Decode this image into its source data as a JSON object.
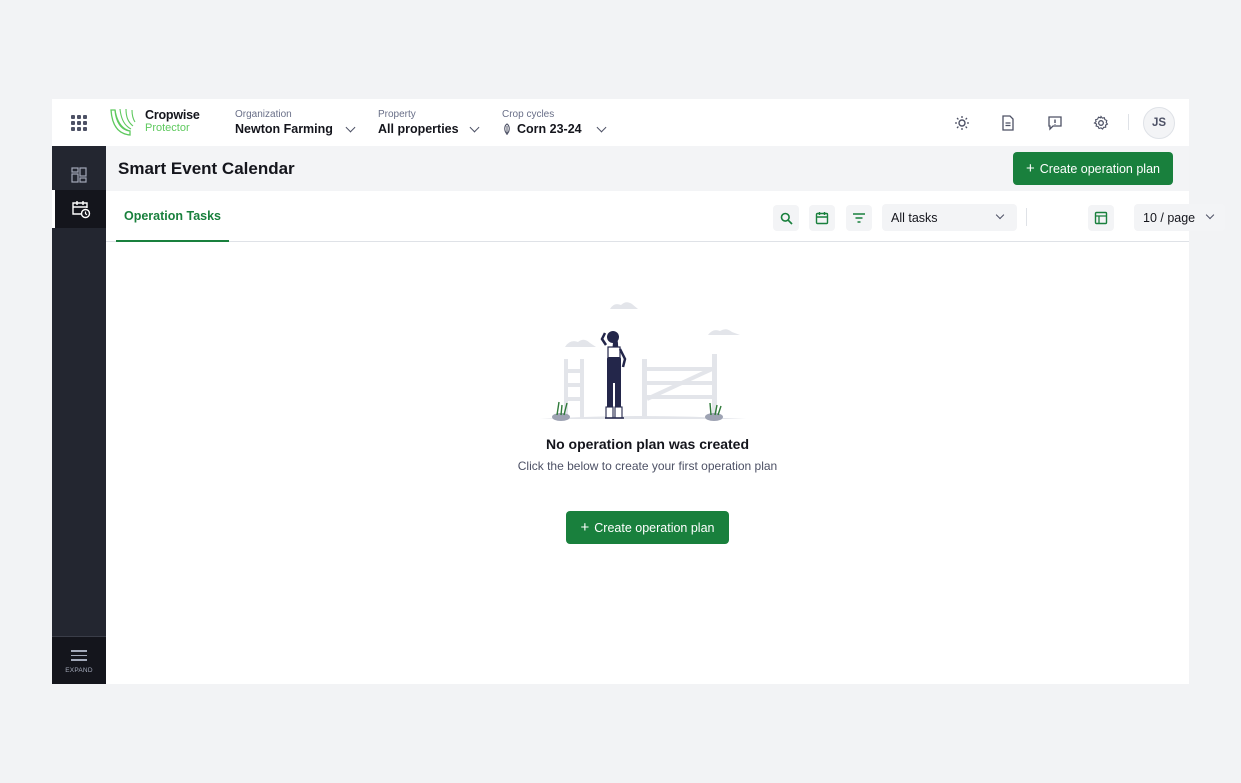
{
  "header": {
    "logo": {
      "name": "Cropwise",
      "product": "Protector"
    },
    "organization": {
      "caption": "Organization",
      "value": "Newton Farming"
    },
    "property": {
      "caption": "Property",
      "value": "All properties"
    },
    "crop_cycles": {
      "caption": "Crop cycles",
      "value": "Corn 23-24"
    },
    "icons": [
      "weather-icon",
      "document-icon",
      "feedback-icon",
      "settings-icon"
    ],
    "avatar_initials": "JS"
  },
  "sidebar": {
    "items": [
      {
        "name": "dashboard",
        "icon": "dashboard-icon",
        "active": false
      },
      {
        "name": "smart-event-calendar",
        "icon": "calendar-clock-icon",
        "active": true
      }
    ],
    "expand_label": "EXPAND"
  },
  "page": {
    "title": "Smart Event Calendar",
    "create_button": "Create operation plan"
  },
  "toolbar": {
    "tab_label": "Operation Tasks",
    "tasks_filter": "All tasks",
    "page_size": "10 / page",
    "icons": [
      "search-icon",
      "calendar-icon",
      "filter-icon",
      "table-view-icon"
    ]
  },
  "empty_state": {
    "title": "No operation plan was created",
    "subtitle": "Click the below to create your first operation plan",
    "button": "Create operation plan"
  },
  "colors": {
    "primary": "#19803d",
    "sidebar": "#232630",
    "sidebar_active": "#14151c",
    "brand_green": "#5ec95e",
    "page_bg": "#f2f3f5"
  }
}
